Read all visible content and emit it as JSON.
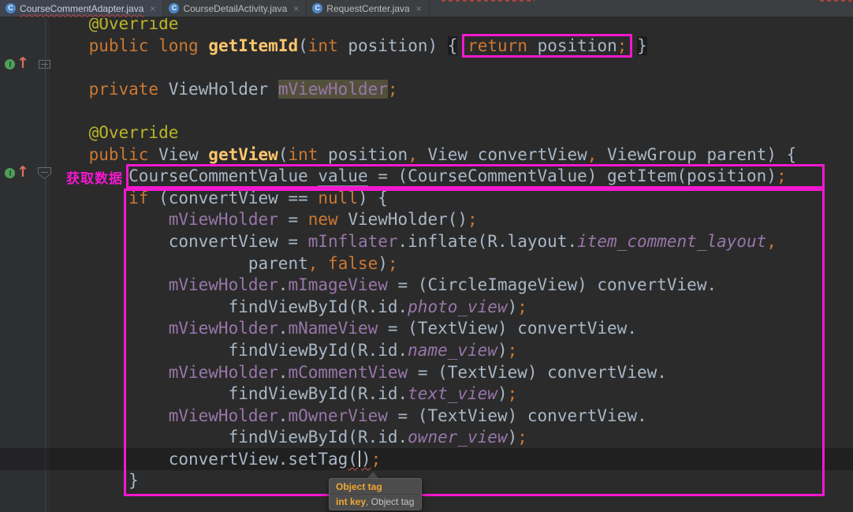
{
  "tabs": [
    {
      "label": "CourseCommentAdapter.java",
      "icon": "java-class-icon",
      "active": true,
      "error_underline": true,
      "close": "×"
    },
    {
      "label": "CourseDetailActivity.java",
      "icon": "java-class-icon",
      "active": false,
      "error_underline": false,
      "close": "×"
    },
    {
      "label": "RequestCenter.java",
      "icon": "java-class-icon",
      "active": false,
      "error_underline": false,
      "close": "×"
    }
  ],
  "annotation": {
    "label": "获取数据"
  },
  "tooltip": {
    "overload1": "Object tag",
    "overload2_current": "int key",
    "overload2_rest": ", Object tag"
  },
  "gutter": {
    "icons": [
      "overrides-method-icon",
      "navigate-up-arrow-icon",
      "fold-expand-icon",
      "fold-collapse-icon"
    ]
  },
  "colors": {
    "editor_bg": "#2B2B2B",
    "tabbar_bg": "#3C3F41",
    "accent_magenta": "#F318CF",
    "keyword": "#CC7832",
    "method_decl": "#FFC66D",
    "annotation_token": "#BBB529",
    "field_purple": "#9876AA",
    "plain_text": "#A9B7C6",
    "identifier_highlight_bg": "#52503A",
    "error_red": "#CF5B56",
    "tooltip_bg": "#4C4C4C",
    "tooltip_param": "#EFA732",
    "gutter_green": "#4F9F5A",
    "gutter_arrow": "#D8705D"
  },
  "code": {
    "lines": [
      {
        "ind": 4,
        "tokens": [
          [
            "a",
            "@Override"
          ]
        ]
      },
      {
        "ind": 4,
        "tokens": [
          [
            "k",
            "public"
          ],
          [
            "p",
            " "
          ],
          [
            "k",
            "long"
          ],
          [
            "p",
            " "
          ],
          [
            "m",
            "getItemId"
          ],
          [
            "p",
            "("
          ],
          [
            "k",
            "int"
          ],
          [
            "p",
            " position) "
          ],
          [
            "br",
            "{"
          ],
          [
            "p",
            " "
          ],
          [
            "k",
            "return"
          ],
          [
            "p",
            " position"
          ],
          [
            "s",
            ";"
          ],
          [
            "p",
            " "
          ],
          [
            "br",
            "}"
          ]
        ]
      },
      {
        "ind": 0,
        "tokens": []
      },
      {
        "ind": 4,
        "tokens": [
          [
            "k",
            "private"
          ],
          [
            "p",
            " ViewHolder "
          ],
          [
            "hl",
            "mViewHolder"
          ],
          [
            "s",
            ";"
          ]
        ]
      },
      {
        "ind": 0,
        "tokens": []
      },
      {
        "ind": 4,
        "tokens": [
          [
            "a",
            "@Override"
          ]
        ]
      },
      {
        "ind": 4,
        "tokens": [
          [
            "k",
            "public"
          ],
          [
            "p",
            " View "
          ],
          [
            "m",
            "getView"
          ],
          [
            "p",
            "("
          ],
          [
            "k",
            "int"
          ],
          [
            "p",
            " position"
          ],
          [
            "s",
            ","
          ],
          [
            "p",
            " View convertView"
          ],
          [
            "s",
            ","
          ],
          [
            "p",
            " ViewGroup parent) {"
          ]
        ]
      },
      {
        "ind": 8,
        "tokens": [
          [
            "p",
            "CourseCommentValue "
          ],
          [
            "u",
            "value"
          ],
          [
            "p",
            " = (CourseCommentValue) getItem(position)"
          ],
          [
            "s",
            ";"
          ]
        ]
      },
      {
        "ind": 8,
        "tokens": [
          [
            "k",
            "if"
          ],
          [
            "p",
            " (convertView == "
          ],
          [
            "k",
            "null"
          ],
          [
            "p",
            ") {"
          ]
        ]
      },
      {
        "ind": 12,
        "tokens": [
          [
            "f",
            "mViewHolder"
          ],
          [
            "p",
            " = "
          ],
          [
            "k",
            "new"
          ],
          [
            "p",
            " ViewHolder()"
          ],
          [
            "s",
            ";"
          ]
        ]
      },
      {
        "ind": 12,
        "tokens": [
          [
            "p",
            "convertView = "
          ],
          [
            "f",
            "mInflater"
          ],
          [
            "p",
            ".inflate(R.layout."
          ],
          [
            "fi",
            "item_comment_layout"
          ],
          [
            "s",
            ","
          ]
        ]
      },
      {
        "ind": 20,
        "tokens": [
          [
            "p",
            "parent"
          ],
          [
            "s",
            ","
          ],
          [
            "p",
            " "
          ],
          [
            "k",
            "false"
          ],
          [
            "p",
            ")"
          ],
          [
            "s",
            ";"
          ]
        ]
      },
      {
        "ind": 12,
        "tokens": [
          [
            "f",
            "mViewHolder"
          ],
          [
            "p",
            "."
          ],
          [
            "f",
            "mImageView"
          ],
          [
            "p",
            " = (CircleImageView) convertView."
          ]
        ]
      },
      {
        "ind": 18,
        "tokens": [
          [
            "p",
            "findViewById(R.id."
          ],
          [
            "fi",
            "photo_view"
          ],
          [
            "p",
            ")"
          ],
          [
            "s",
            ";"
          ]
        ]
      },
      {
        "ind": 12,
        "tokens": [
          [
            "f",
            "mViewHolder"
          ],
          [
            "p",
            "."
          ],
          [
            "f",
            "mNameView"
          ],
          [
            "p",
            " = (TextView) convertView."
          ]
        ]
      },
      {
        "ind": 18,
        "tokens": [
          [
            "p",
            "findViewById(R.id."
          ],
          [
            "fi",
            "name_view"
          ],
          [
            "p",
            ")"
          ],
          [
            "s",
            ";"
          ]
        ]
      },
      {
        "ind": 12,
        "tokens": [
          [
            "f",
            "mViewHolder"
          ],
          [
            "p",
            "."
          ],
          [
            "f",
            "mCommentView"
          ],
          [
            "p",
            " = (TextView) convertView."
          ]
        ]
      },
      {
        "ind": 18,
        "tokens": [
          [
            "p",
            "findViewById(R.id."
          ],
          [
            "fi",
            "text_view"
          ],
          [
            "p",
            ")"
          ],
          [
            "s",
            ";"
          ]
        ]
      },
      {
        "ind": 12,
        "tokens": [
          [
            "f",
            "mViewHolder"
          ],
          [
            "p",
            "."
          ],
          [
            "f",
            "mOwnerView"
          ],
          [
            "p",
            " = (TextView) convertView."
          ]
        ]
      },
      {
        "ind": 18,
        "tokens": [
          [
            "p",
            "findViewById(R.id."
          ],
          [
            "fi",
            "owner_view"
          ],
          [
            "p",
            ")"
          ],
          [
            "s",
            ";"
          ]
        ]
      },
      {
        "ind": 12,
        "tokens": [
          [
            "p",
            "convertView.setTag"
          ],
          [
            "perr",
            "("
          ],
          [
            "caret",
            ""
          ],
          [
            "perr",
            ")"
          ],
          [
            "s",
            ";"
          ]
        ]
      },
      {
        "ind": 8,
        "tokens": [
          [
            "p",
            "}"
          ]
        ]
      }
    ]
  }
}
